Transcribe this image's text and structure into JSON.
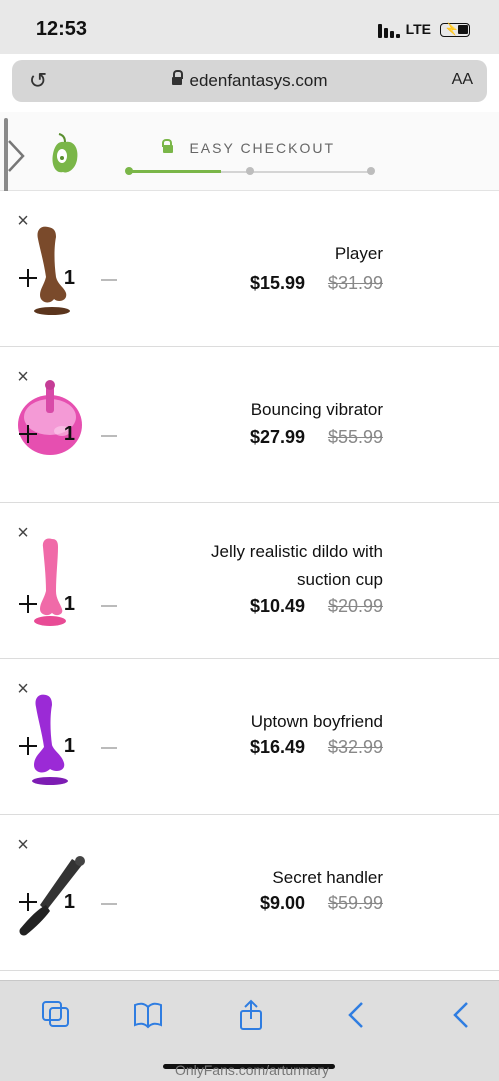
{
  "status_bar": {
    "time": "12:53",
    "network": "LTE"
  },
  "address_bar": {
    "domain": "edenfantasys.com",
    "reader_label": "AA"
  },
  "checkout": {
    "label": "EASY CHECKOUT"
  },
  "cart": {
    "items": [
      {
        "title": "Player",
        "old_price": "$31.99",
        "price": "$15.99",
        "qty": "1"
      },
      {
        "title": "Bouncing vibrator",
        "old_price": "$55.99",
        "price": "$27.99",
        "qty": "1"
      },
      {
        "title_line1": "Jelly realistic dildo with",
        "title_line2": "suction cup",
        "old_price": "$20.99",
        "price": "$10.49",
        "qty": "1"
      },
      {
        "title": "Uptown boyfriend",
        "old_price": "$32.99",
        "price": "$16.49",
        "qty": "1"
      },
      {
        "title": "Secret handler",
        "old_price": "$59.99",
        "price": "$9.00",
        "qty": "1"
      }
    ]
  },
  "watermark": "OnlyFans.com/arturmary",
  "colors": {
    "accent": "#7ab648",
    "toolbar_icon": "#2f7de1"
  },
  "icons": [
    "reload-icon",
    "lock-icon",
    "back-chevron-icon",
    "logo-icon",
    "close-icon",
    "tabs-icon",
    "bookmarks-icon",
    "share-icon",
    "back-icon",
    "forward-icon"
  ]
}
